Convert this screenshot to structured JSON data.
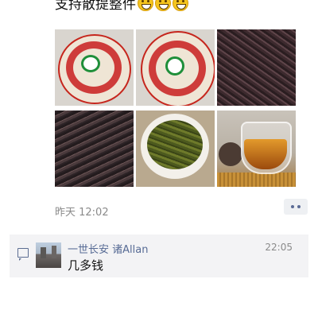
{
  "post": {
    "line1": "支持散提整件",
    "emojis": [
      "grin-emoji",
      "grin-emoji",
      "grin-emoji"
    ]
  },
  "photos": [
    {
      "name": "tea-cake-front-photo"
    },
    {
      "name": "tea-cake-side-photo"
    },
    {
      "name": "tea-leaves-closeup-photo"
    },
    {
      "name": "tea-leaves-pile-photo"
    },
    {
      "name": "brewed-leaves-bowl-photo"
    },
    {
      "name": "tea-cup-photo"
    }
  ],
  "meta": {
    "time": "昨天 12:02"
  },
  "comment": {
    "user": "一世长安  诸Allan",
    "time": "22:05",
    "text": "几多钱"
  },
  "colors": {
    "link": "#576b95",
    "comment_bg": "#f3f3f5",
    "muted": "#8a8a8a"
  }
}
